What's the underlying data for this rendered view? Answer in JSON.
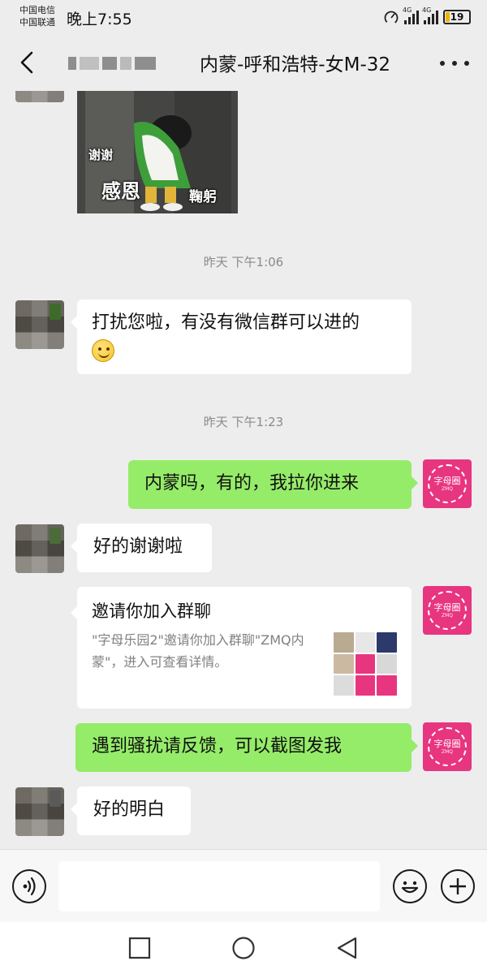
{
  "status_bar": {
    "carrier_1": "中国电信",
    "carrier_2": "中国联通",
    "time": "晚上7:55",
    "signal_1_label": "4G",
    "signal_2_label": "4G",
    "battery": "19",
    "battery_level": 0.19,
    "battery_color": "#f0b400"
  },
  "nav": {
    "title": "内蒙-呼和浩特-女M-32",
    "back_icon": "chevron-left-icon",
    "more_icon": "more-dots-icon"
  },
  "sticker": {
    "caption_1": "谢谢",
    "caption_2": "感恩",
    "caption_3": "鞠躬"
  },
  "timestamps": [
    "昨天 下午1:06",
    "昨天 下午1:23"
  ],
  "messages": [
    {
      "side": "in",
      "text": "打扰您啦，有没有微信群可以进的",
      "emoji": "smile"
    },
    {
      "side": "out",
      "text": "内蒙吗，有的，我拉你进来"
    },
    {
      "side": "in",
      "text": "好的谢谢啦"
    },
    {
      "side": "out",
      "text": "遇到骚扰请反馈，可以截图发我"
    },
    {
      "side": "in",
      "text": "好的明白"
    }
  ],
  "invite_card": {
    "title": "邀请你加入群聊",
    "description": "\"字母乐园2\"邀请你加入群聊\"ZMQ内蒙\"，进入可查看详情。"
  },
  "brand_avatar": {
    "text": "字母圈",
    "subtext": "ZMQ",
    "color": "#e8357f"
  },
  "colors": {
    "out_bubble": "#95ec69",
    "in_bubble": "#ffffff",
    "background": "#ededed"
  },
  "input_bar": {
    "placeholder": "",
    "voice_icon": "voice-icon",
    "emoji_icon": "emoji-icon",
    "plus_icon": "plus-icon"
  },
  "system_nav": {
    "recent_icon": "square-recent-icon",
    "home_icon": "circle-home-icon",
    "back_icon": "triangle-back-icon"
  }
}
